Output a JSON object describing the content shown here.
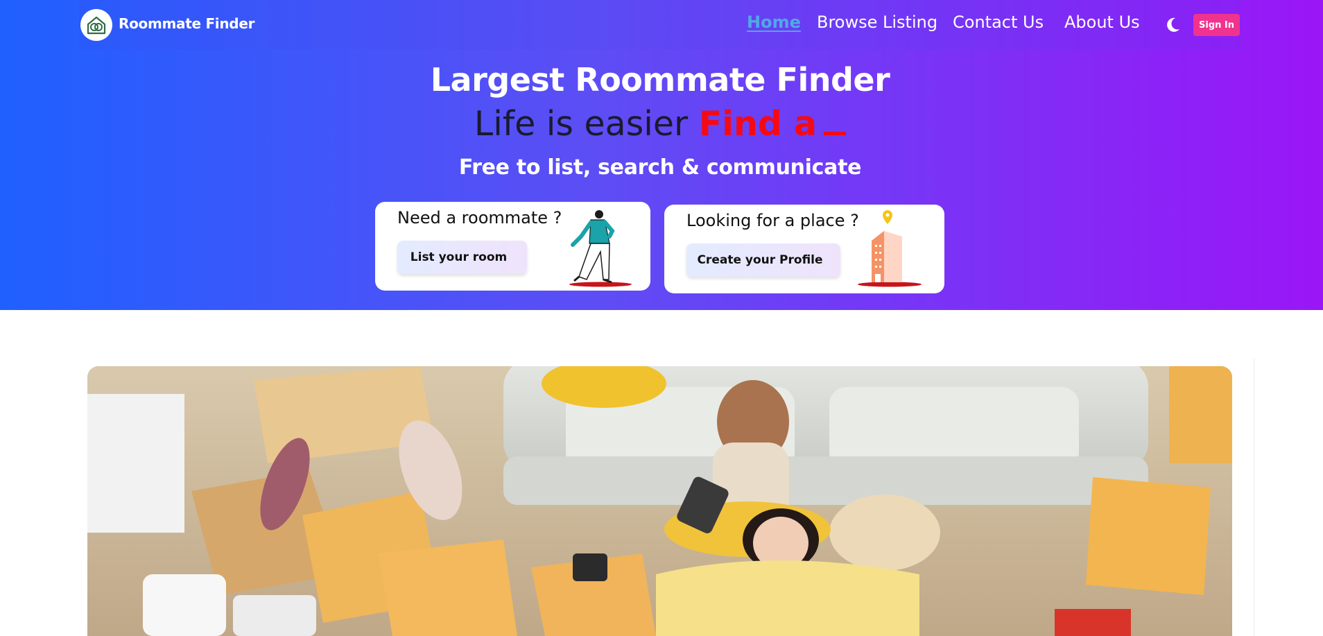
{
  "brand": {
    "name": "Roommate Finder",
    "logo_icon": "house-heart-logo-icon"
  },
  "nav": {
    "items": [
      {
        "label": "Home",
        "active": true
      },
      {
        "label": "Browse Listing",
        "active": false
      },
      {
        "label": "Contact Us",
        "active": false
      },
      {
        "label": "About Us",
        "active": false
      }
    ],
    "theme_toggle_icon": "moon-icon",
    "signin_label": "Sign In"
  },
  "hero": {
    "title": "Largest Roommate Finder",
    "subtitle_prefix": "Life is easier",
    "subtitle_typed": "Find a",
    "tagline": "Free to list, search & communicate"
  },
  "cards": {
    "roommate": {
      "title": "Need a roommate ?",
      "button": "List your room",
      "illustration": "walking-person-illustration"
    },
    "place": {
      "title": "Looking for a place ?",
      "button": "Create your Profile",
      "illustration": "building-with-pin-illustration"
    }
  },
  "colors": {
    "gradient_start": "#1f60ff",
    "gradient_end": "#9a16f7",
    "accent_red": "#f50a14",
    "signin_pink": "#f0338e",
    "active_nav": "#52a8e6"
  },
  "photo": {
    "subject": "two roommates sitting among moving boxes in living room"
  }
}
